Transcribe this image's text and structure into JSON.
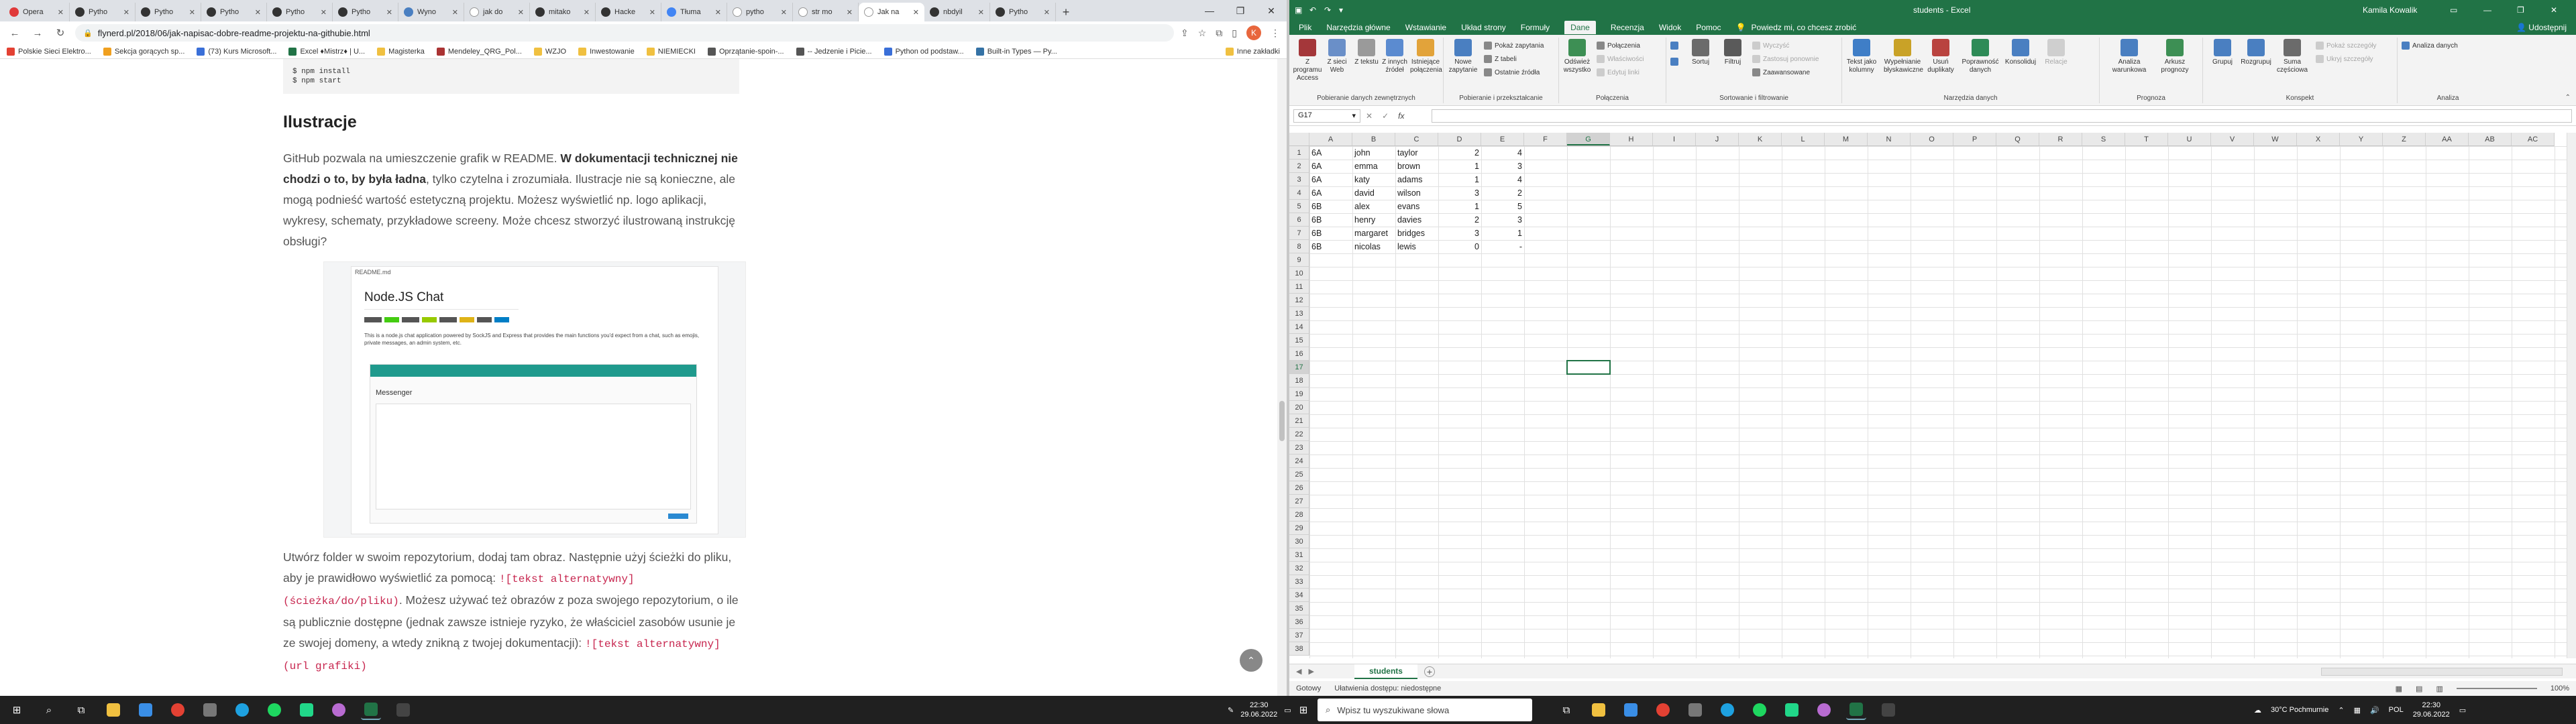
{
  "browser": {
    "tabs": [
      {
        "label": "Opera"
      },
      {
        "label": "Pytho"
      },
      {
        "label": "Pytho"
      },
      {
        "label": "Pytho"
      },
      {
        "label": "Pytho"
      },
      {
        "label": "Pytho"
      },
      {
        "label": "Wyno"
      },
      {
        "label": "jak do"
      },
      {
        "label": "mitako"
      },
      {
        "label": "Hacke"
      },
      {
        "label": "Tłuma"
      },
      {
        "label": "pytho"
      },
      {
        "label": "str mo"
      },
      {
        "label": "Jak na"
      },
      {
        "label": "nbdyil"
      },
      {
        "label": "Pytho"
      }
    ],
    "new_tab": "+",
    "url": "flynerd.pl/2018/06/jak-napisac-dobre-readme-projektu-na-githubie.html",
    "profile_initial": "K",
    "bookmarks": [
      "Polskie Sieci Elektro...",
      "Sekcja gorących sp...",
      "(73) Kurs Microsoft...",
      "Excel ♦Mistrz♦ | U...",
      "Magisterka",
      "Mendeley_QRG_Pol...",
      "WZJO",
      "Inwestowanie",
      "NIEMIECKI",
      "Oprzątanie-spoin-...",
      "-- Jedzenie i Picie...",
      "Python od podstaw...",
      "Built-in Types — Py...",
      "Inne zakładki"
    ],
    "article": {
      "code_lines": [
        "$ npm install",
        "$ npm start"
      ],
      "heading": "Ilustracje",
      "para1_a": "GitHub pozwala na umieszczenie grafik w README. ",
      "para1_bold": "W dokumentacji technicznej nie chodzi o to, by była ładna",
      "para1_b": ", tylko czytelna i zrozumiała. Ilustracje nie są konieczne, ale mogą podnieść wartość estetyczną projektu. Możesz wyświetlić np. logo aplikacji, wykresy, schematy, przykładowe screeny. Może chcesz stworzyć ilustrowaną instrukcję obsługi?",
      "figure": {
        "file_label": "README.md",
        "title": "Node.JS Chat",
        "desc": "This is a node.js chat application powered by SockJS and Express that provides the main functions you'd expect from a chat, such as emojis, private messages, an admin system, etc.",
        "messenger_label": "Messenger"
      },
      "para2_a": "Utwórz folder w swoim repozytorium, dodaj tam obraz. Następnie użyj ścieżki do pliku, aby je prawidłowo wyświetlić za pomocą: ",
      "para2_code": "![tekst alternatywny](ścieżka/do/pliku)",
      "para2_b": ". Możesz używać też obrazów z poza swojego repozytorium, o ile są publicznie dostępne (jednak zawsze istnieje ryzyko, że właściciel zasobów usunie je ze swojej domeny, a wtedy znikną z twojej dokumentacji): ",
      "para2_code2": "![tekst alternatywny](url grafiki)"
    }
  },
  "excel": {
    "title": "students - Excel",
    "user": "Kamila Kowalik",
    "share": "Udostępnij",
    "ribbon_tabs": [
      "Plik",
      "Narzędzia główne",
      "Wstawianie",
      "Układ strony",
      "Formuły",
      "Dane",
      "Recenzja",
      "Widok",
      "Pomoc"
    ],
    "active_tab": "Dane",
    "tell_me": "Powiedz mi, co chcesz zrobić",
    "groups": {
      "get_data": {
        "label": "Pobieranie danych zewnętrznych",
        "buttons": [
          "Z programu Access",
          "Z sieci Web",
          "Z tekstu",
          "Z innych źródeł",
          "Istniejące połączenia"
        ]
      },
      "transform": {
        "label": "Pobieranie i przekształcanie",
        "new_query": "Nowe zapytanie",
        "show_queries": "Pokaż zapytania",
        "from_table": "Z tabeli",
        "recent_sources": "Ostatnie źródła"
      },
      "connections": {
        "label": "Połączenia",
        "refresh": "Odśwież wszystko",
        "connections": "Połączenia",
        "properties": "Właściwości",
        "edit_links": "Edytuj linki"
      },
      "sort_filter": {
        "label": "Sortowanie i filtrowanie",
        "sort": "Sortuj",
        "filter": "Filtruj",
        "clear": "Wyczyść",
        "reapply": "Zastosuj ponownie",
        "advanced": "Zaawansowane"
      },
      "data_tools": {
        "label": "Narzędzia danych",
        "buttons": [
          "Tekst jako kolumny",
          "Wypełnianie błyskawiczne",
          "Usuń duplikaty",
          "Poprawność danych",
          "Konsoliduj",
          "Relacje"
        ]
      },
      "forecast": {
        "label": "Prognoza",
        "buttons": [
          "Analiza warunkowa",
          "Arkusz prognozy"
        ]
      },
      "outline": {
        "label": "Konspekt",
        "buttons": [
          "Grupuj",
          "Rozgrupuj",
          "Suma częściowa"
        ],
        "show_detail": "Pokaż szczegóły",
        "hide_detail": "Ukryj szczegóły"
      },
      "analysis": {
        "label": "Analiza",
        "data_analysis": "Analiza danych"
      }
    },
    "name_box": "G17",
    "columns": [
      "A",
      "B",
      "C",
      "D",
      "E",
      "F",
      "G",
      "H",
      "I",
      "J",
      "K",
      "L",
      "M",
      "N",
      "O",
      "P",
      "Q",
      "R",
      "S",
      "T",
      "U",
      "V",
      "W",
      "X",
      "Y",
      "Z",
      "AA",
      "AB",
      "AC"
    ],
    "row_count": 38,
    "data_rows": [
      {
        "a": "6A",
        "b": "john",
        "c": "taylor",
        "d": "2",
        "e": "4"
      },
      {
        "a": "6A",
        "b": "emma",
        "c": "brown",
        "d": "1",
        "e": "3"
      },
      {
        "a": "6A",
        "b": "katy",
        "c": "adams",
        "d": "1",
        "e": "4"
      },
      {
        "a": "6A",
        "b": "david",
        "c": "wilson",
        "d": "3",
        "e": "2"
      },
      {
        "a": "6B",
        "b": "alex",
        "c": "evans",
        "d": "1",
        "e": "5"
      },
      {
        "a": "6B",
        "b": "henry",
        "c": "davies",
        "d": "2",
        "e": "3"
      },
      {
        "a": "6B",
        "b": "margaret",
        "c": "bridges",
        "d": "3",
        "e": "1"
      },
      {
        "a": "6B",
        "b": "nicolas",
        "c": "lewis",
        "d": "0",
        "e": "-"
      }
    ],
    "sheet_name": "students",
    "status": {
      "ready": "Gotowy",
      "accessibility": "Ułatwienia dostępu: niedostępne",
      "zoom": "100%"
    }
  },
  "taskbar": {
    "search_placeholder": "Wpisz tu wyszukiwane słowa",
    "time_left": "22:30",
    "date_left": "29.06.2022",
    "weather": "30°C  Pochmurnie",
    "lang": "POL",
    "time_right": "22:30",
    "date_right": "29.06.2022"
  },
  "colors": {
    "excel_green": "#217346",
    "taskbar": "#202020",
    "accent_code": "#c7254e"
  }
}
